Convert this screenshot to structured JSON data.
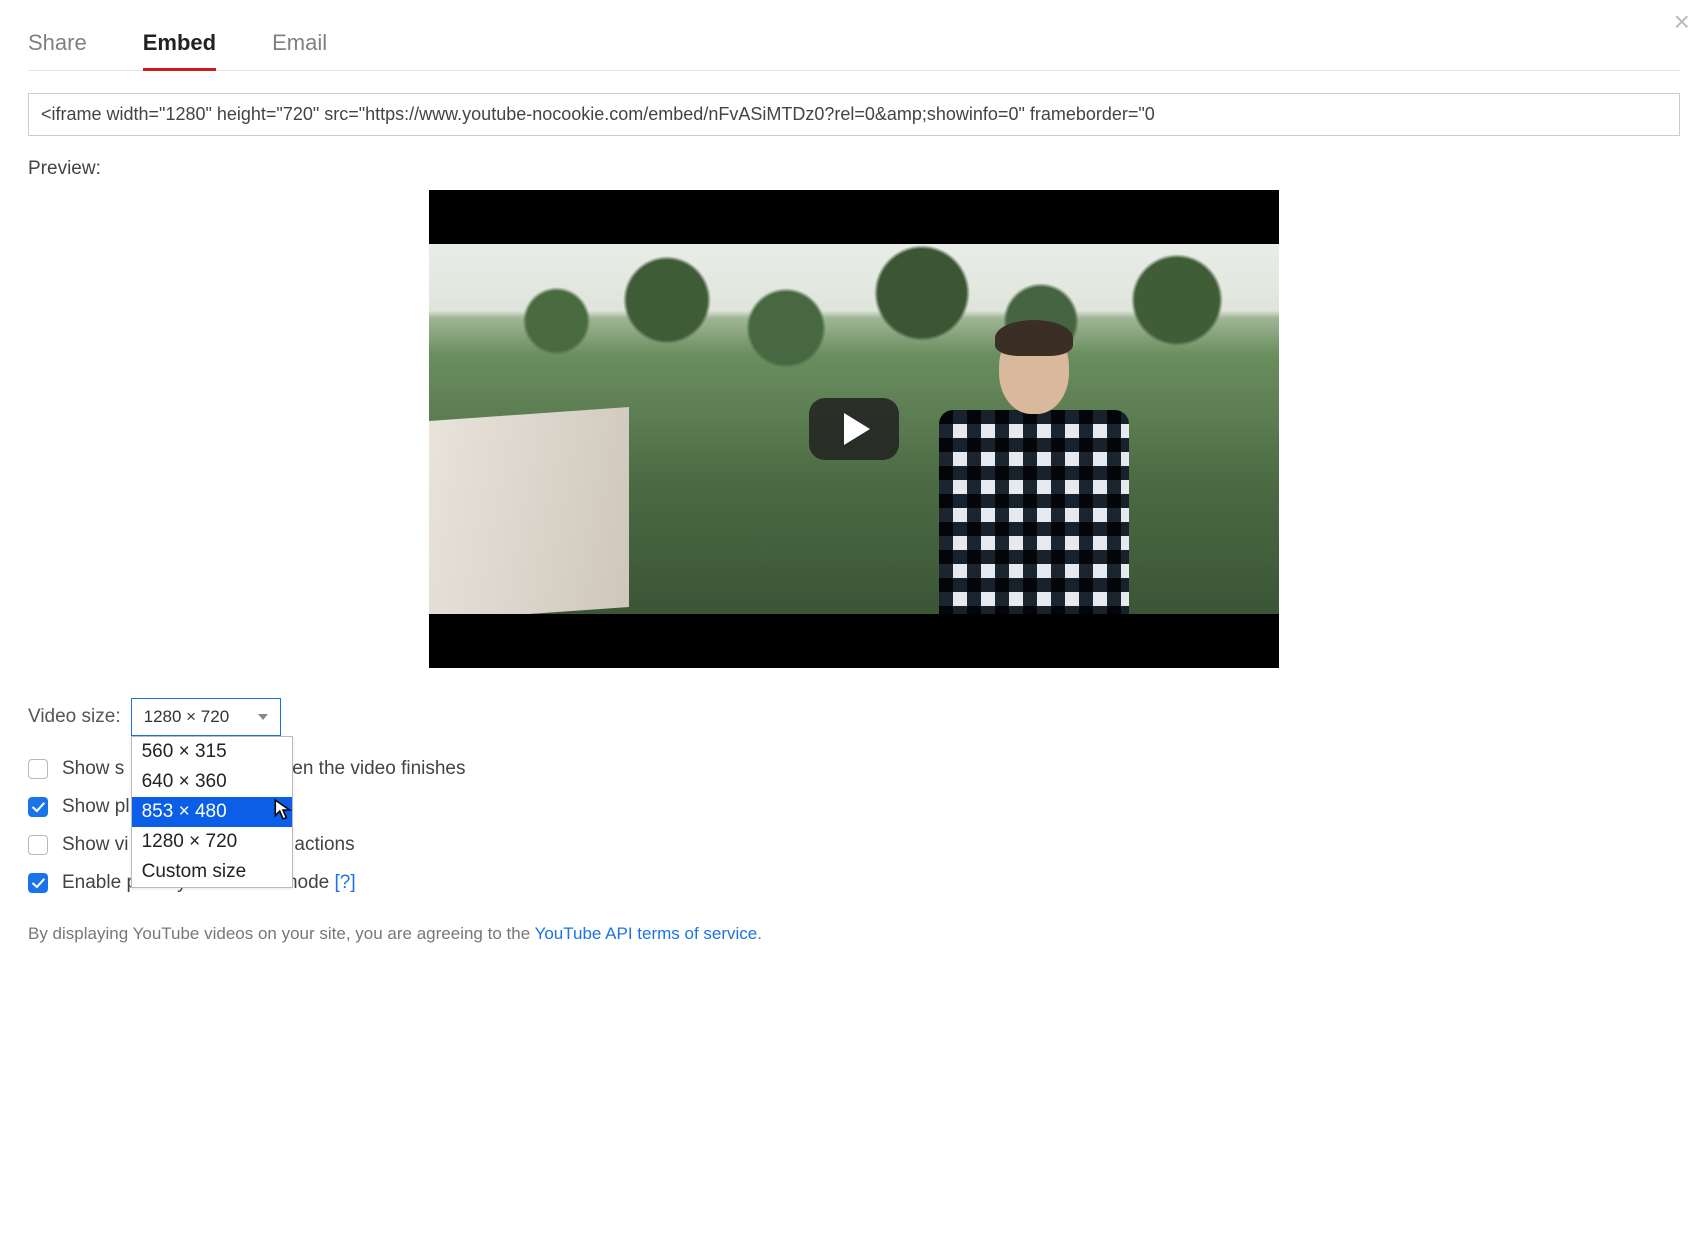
{
  "tabs": {
    "share": "Share",
    "embed": "Embed",
    "email": "Email"
  },
  "embed_code": "<iframe width=\"1280\" height=\"720\" src=\"https://www.youtube-nocookie.com/embed/nFvASiMTDz0?rel=0&amp;showinfo=0\" frameborder=\"0",
  "preview_label": "Preview:",
  "video_size": {
    "label": "Video size:",
    "selected": "1280 × 720",
    "options": {
      "o0": "560 × 315",
      "o1": "640 × 360",
      "o2": "853 × 480",
      "o3": "1280 × 720",
      "o4": "Custom size"
    }
  },
  "options": {
    "suggested": {
      "label_before": "Show s",
      "label_after": "hen the video finishes",
      "checked": false
    },
    "controls": {
      "label": "Show pl",
      "checked": true
    },
    "title": {
      "label_before": "Show vi",
      "label_after": "r actions",
      "checked": false
    },
    "privacy": {
      "label": "Enable privacy-enhanced mode ",
      "help": "[?]",
      "checked": true
    }
  },
  "footer": {
    "prefix": "By displaying YouTube videos on your site, you are agreeing to the ",
    "link": "YouTube API terms of service",
    "suffix": "."
  }
}
